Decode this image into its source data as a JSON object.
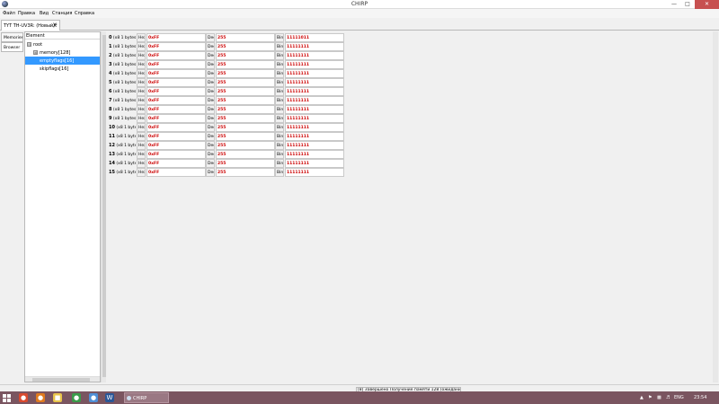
{
  "window": {
    "title": "CHIRP"
  },
  "menu": {
    "items": [
      "Файл",
      "Правка",
      "Вид",
      "Станция",
      "Справка"
    ]
  },
  "tabs": {
    "doc_tab": "TYT TH-UV3R: (Новый)*",
    "close_glyph": "X"
  },
  "side_tabs": [
    "Memories",
    "Browser"
  ],
  "tree": {
    "header": "Element",
    "rows": [
      {
        "label": "root",
        "expander": "⊟"
      },
      {
        "label": "memory[128]",
        "expander": "⊞"
      },
      {
        "label": "emptyflags[16]",
        "expander": ""
      },
      {
        "label": "skipflags[16]",
        "expander": ""
      }
    ]
  },
  "grid": {
    "hex_label": "Hex",
    "dec_label": "Dec",
    "bin_label": "Bin",
    "rows": [
      {
        "index": "0",
        "size": "(x8 1 bytes)",
        "hex": "0xFF",
        "dec": "255",
        "bin": "11111011"
      },
      {
        "index": "1",
        "size": "(x8 1 bytes)",
        "hex": "0xFF",
        "dec": "255",
        "bin": "11111111"
      },
      {
        "index": "2",
        "size": "(x8 1 bytes)",
        "hex": "0xFF",
        "dec": "255",
        "bin": "11111111"
      },
      {
        "index": "3",
        "size": "(x8 1 bytes)",
        "hex": "0xFF",
        "dec": "255",
        "bin": "11111111"
      },
      {
        "index": "4",
        "size": "(x8 1 bytes)",
        "hex": "0xFF",
        "dec": "255",
        "bin": "11111111"
      },
      {
        "index": "5",
        "size": "(x8 1 bytes)",
        "hex": "0xFF",
        "dec": "255",
        "bin": "11111111"
      },
      {
        "index": "6",
        "size": "(x8 1 bytes)",
        "hex": "0xFF",
        "dec": "255",
        "bin": "11111111"
      },
      {
        "index": "7",
        "size": "(x8 1 bytes)",
        "hex": "0xFF",
        "dec": "255",
        "bin": "11111111"
      },
      {
        "index": "8",
        "size": "(x8 1 bytes)",
        "hex": "0xFF",
        "dec": "255",
        "bin": "11111111"
      },
      {
        "index": "9",
        "size": "(x8 1 bytes)",
        "hex": "0xFF",
        "dec": "255",
        "bin": "11111111"
      },
      {
        "index": "10",
        "size": "(x8 1 bytes)",
        "hex": "0xFF",
        "dec": "255",
        "bin": "11111111"
      },
      {
        "index": "11",
        "size": "(x8 1 bytes)",
        "hex": "0xFF",
        "dec": "255",
        "bin": "11111111"
      },
      {
        "index": "12",
        "size": "(x8 1 bytes)",
        "hex": "0xFF",
        "dec": "255",
        "bin": "11111111"
      },
      {
        "index": "13",
        "size": "(x8 1 bytes)",
        "hex": "0xFF",
        "dec": "255",
        "bin": "11111111"
      },
      {
        "index": "14",
        "size": "(x8 1 bytes)",
        "hex": "0xFF",
        "dec": "255",
        "bin": "11111111"
      },
      {
        "index": "15",
        "size": "(x8 1 bytes)",
        "hex": "0xFF",
        "dec": "255",
        "bin": "11111111"
      }
    ]
  },
  "status": {
    "text": "[8] Завершено Получение памяти 128 (ожидание)"
  },
  "taskbar": {
    "task_label": "CHIRP",
    "language": "ENG",
    "clock": "23:54"
  },
  "colors": {
    "value_red": "#cc0000",
    "selection_blue": "#3399ff",
    "taskbar": "#7a5560",
    "close_red": "#c75050"
  }
}
